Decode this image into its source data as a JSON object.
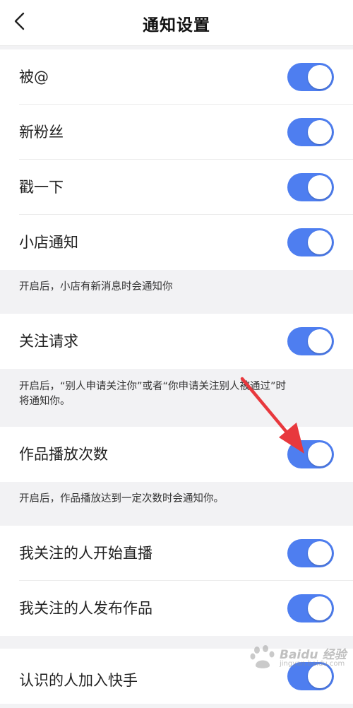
{
  "header": {
    "title": "通知设置",
    "back_icon": "chevron-left-icon"
  },
  "colors": {
    "accent": "#4e7ef0",
    "arrow": "#e8383d",
    "background": "#f2f2f4"
  },
  "settings": [
    {
      "label": "被@",
      "enabled": true
    },
    {
      "label": "新粉丝",
      "enabled": true
    },
    {
      "label": "戳一下",
      "enabled": true
    },
    {
      "label": "小店通知",
      "enabled": true,
      "hint": "开启后，小店有新消息时会通知你"
    },
    {
      "label": "关注请求",
      "enabled": true,
      "hint_line1": "开启后，“别人申请关注你”或者“你申请关注别人被通过”时",
      "hint_line2": "将通知你。"
    },
    {
      "label": "作品播放次数",
      "enabled": true,
      "hint": "开启后，作品播放达到一定次数时会通知你。"
    },
    {
      "label": "我关注的人开始直播",
      "enabled": true
    },
    {
      "label": "我关注的人发布作品",
      "enabled": true
    },
    {
      "label": "认识的人加入快手",
      "enabled": true
    }
  ],
  "watermark": {
    "text": "Baidu 经验",
    "url": "jingyan.baidu.com"
  }
}
